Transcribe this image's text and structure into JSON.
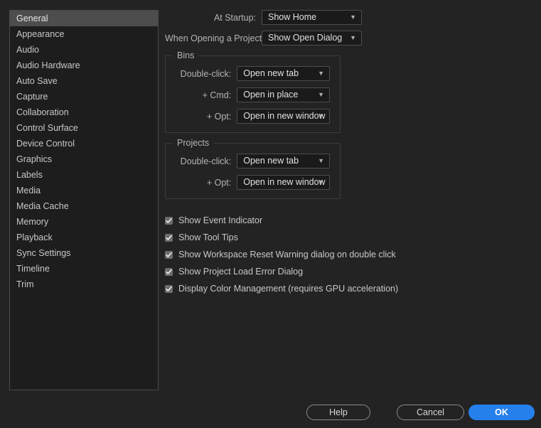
{
  "sidebar": {
    "items": [
      {
        "label": "General",
        "selected": true
      },
      {
        "label": "Appearance",
        "selected": false
      },
      {
        "label": "Audio",
        "selected": false
      },
      {
        "label": "Audio Hardware",
        "selected": false
      },
      {
        "label": "Auto Save",
        "selected": false
      },
      {
        "label": "Capture",
        "selected": false
      },
      {
        "label": "Collaboration",
        "selected": false
      },
      {
        "label": "Control Surface",
        "selected": false
      },
      {
        "label": "Device Control",
        "selected": false
      },
      {
        "label": "Graphics",
        "selected": false
      },
      {
        "label": "Labels",
        "selected": false
      },
      {
        "label": "Media",
        "selected": false
      },
      {
        "label": "Media Cache",
        "selected": false
      },
      {
        "label": "Memory",
        "selected": false
      },
      {
        "label": "Playback",
        "selected": false
      },
      {
        "label": "Sync Settings",
        "selected": false
      },
      {
        "label": "Timeline",
        "selected": false
      },
      {
        "label": "Trim",
        "selected": false
      }
    ]
  },
  "general": {
    "startup": {
      "label": "At Startup:",
      "value": "Show Home"
    },
    "opening_project": {
      "label": "When Opening a Project:",
      "value": "Show Open Dialog"
    },
    "bins": {
      "legend": "Bins",
      "rows": [
        {
          "label": "Double-click:",
          "value": "Open new tab"
        },
        {
          "label": "+ Cmd:",
          "value": "Open in place"
        },
        {
          "label": "+ Opt:",
          "value": "Open in new window"
        }
      ]
    },
    "projects": {
      "legend": "Projects",
      "rows": [
        {
          "label": "Double-click:",
          "value": "Open new tab"
        },
        {
          "label": "+ Opt:",
          "value": "Open in new window"
        }
      ]
    },
    "checkboxes": [
      {
        "label": "Show Event Indicator",
        "checked": true
      },
      {
        "label": "Show Tool Tips",
        "checked": true
      },
      {
        "label": "Show Workspace Reset Warning dialog on double click",
        "checked": true
      },
      {
        "label": "Show Project Load Error Dialog",
        "checked": true
      },
      {
        "label": "Display Color Management (requires GPU acceleration)",
        "checked": true
      }
    ]
  },
  "footer": {
    "help_label": "Help",
    "cancel_label": "Cancel",
    "ok_label": "OK"
  },
  "icons": {
    "chevron_down": "⌄",
    "checkmark": "check-icon"
  },
  "colors": {
    "accent": "#2680eb",
    "dialog_bg": "#232323",
    "list_bg": "#1d1d1d",
    "selected_bg": "#4d4d4d",
    "field_bg": "#1a1a1a"
  }
}
